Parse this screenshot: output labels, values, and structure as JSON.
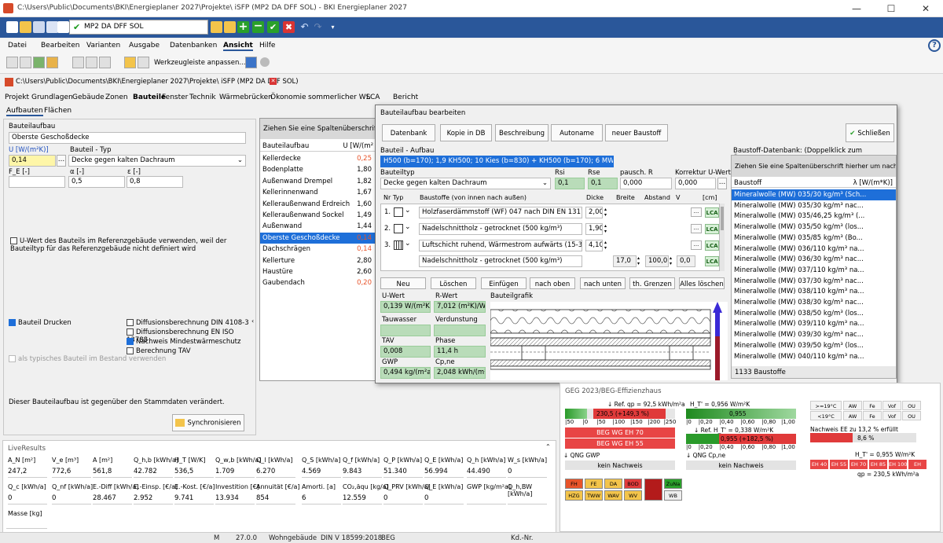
{
  "window": {
    "title": "C:\\Users\\Public\\Documents\\BKI\\Energieplaner 2027\\Projekte\\ iSFP (MP2 DA DFF SOL) - BKI Energieplaner 2027",
    "minimize": "—",
    "maximize": "☐",
    "close": "✕"
  },
  "qat": {
    "combo_value": "MP2 DA DFF SOL"
  },
  "menu": {
    "items": [
      "Datei",
      "Bearbeiten",
      "Varianten",
      "Ausgabe",
      "Datenbanken",
      "Ansicht",
      "Hilfe"
    ],
    "toolbar_customize": "Werkzeugleiste anpassen..."
  },
  "doc": {
    "path": "C:\\Users\\Public\\Documents\\BKI\\Energieplaner 2027\\Projekte\\ iSFP (MP2 DA DFF SOL)"
  },
  "navtabs": [
    "Projekt",
    "Grundlagen",
    "Gebäude",
    "Zonen",
    "Bauteile",
    "Fenster",
    "Technik",
    "Wärmebrücken",
    "Ökonomie",
    "sommerlicher WS",
    "LCA",
    "Bericht"
  ],
  "subtabs": [
    "Aufbauten",
    "Flächen"
  ],
  "left": {
    "bauteilaufbau_label": "Bauteilaufbau",
    "bauteilaufbau_value": "Oberste Geschoßdecke",
    "u_label": "U [W/(m²K)]",
    "u_value": "0,14",
    "typ_label": "Bauteil - Typ",
    "typ_value": "Decke gegen kalten Dachraum",
    "f_label": "F_E [-]",
    "alpha_label": "α [-]",
    "alpha_value": "0,5",
    "eps_label": "ε [-]",
    "eps_value": "0,8",
    "ref_checkbox": "U-Wert des Bauteils im Referenzgebäude verwenden, weil der Bauteiltyp für das Referenzgebäude nicht definiert wird",
    "drucken": "Bauteil Drucken",
    "diff1": "Diffusionsberechnung DIN 4108-3",
    "diff2": "Diffusionsberechnung EN ISO 13788",
    "nachweis": "Nachweis Mindestwärmeschutz",
    "tav": "Berechnung TAV",
    "bestand": "als typisches Bauteil im Bestand verwenden",
    "changed_note": "Dieser Bauteilaufbau ist gegenüber den Stammdaten verändert.",
    "sync_button": "Synchronisieren"
  },
  "grid": {
    "group_hint": "Ziehen Sie eine Spaltenüberschrift hier",
    "col1": "Bauteilaufbau",
    "col2": "U [W/(m²",
    "rows": [
      [
        "Kellerdecke",
        "0,25"
      ],
      [
        "Bodenplatte",
        "1,80"
      ],
      [
        "Außenwand Drempel",
        "1,82"
      ],
      [
        "Kellerinnenwand",
        "1,67"
      ],
      [
        "Kelleraußenwand Erdreich",
        "1,60"
      ],
      [
        "Kelleraußenwand Sockel",
        "1,49"
      ],
      [
        "Außenwand",
        "1,44"
      ],
      [
        "Oberste Geschoßdecke",
        "0,14"
      ],
      [
        "Dachschrägen",
        "0,14"
      ],
      [
        "Kellerture",
        "2,80"
      ],
      [
        "Haustüre",
        "2,60"
      ],
      [
        "Gaubendach",
        "0,20"
      ]
    ]
  },
  "dialog": {
    "title": "Bauteilaufbau bearbeiten",
    "buttons": [
      "Datenbank",
      "Kopie in DB",
      "Beschreibung",
      "Autoname",
      "neuer Baustoff"
    ],
    "close": "Schließen",
    "aufbau_label": "Bauteil - Aufbau",
    "aufbau_value": "H500 (b=170); 1,9 KH500; 10 Kies (b=830) + KH500 (b=170); 6 MW035 (b=830) +",
    "typ_label": "Bauteiltyp",
    "typ_value": "Decke gegen kalten Dachraum",
    "rsi_label": "Rsi",
    "rsi": "0,1",
    "rse_label": "Rse",
    "rse": "0,1",
    "pausch_label": "pausch. R",
    "pausch": "0,000",
    "korr_label": "Korrektur U-Wert",
    "korr": "0,000",
    "table_headers": [
      "Nr Typ",
      "Baustoffe (von innen nach außen)",
      "Dicke",
      "Breite",
      "Abstand",
      "V",
      "[cm]"
    ],
    "layers": [
      {
        "nr": "1.",
        "name": "Holzfaserdämmstoff (WF) 047 nach DIN EN 13171",
        "d": "2,00"
      },
      {
        "nr": "2.",
        "name": "Nadelschnittholz - getrocknet (500 kg/m³)",
        "d": "1,90"
      },
      {
        "nr": "3.",
        "name": "Luftschicht ruhend, Wärmestrom aufwärts (15-300 mm)",
        "d": "4,10"
      }
    ],
    "sub_layer": {
      "name": "Nadelschnittholz - getrocknet (500 kg/m³)",
      "b": "17,0",
      "a": "100,0",
      "v": "0,0"
    },
    "actions": [
      "Neu",
      "Löschen",
      "Einfügen",
      "nach oben",
      "nach unten",
      "th. Grenzen",
      "Alles löschen"
    ],
    "res": {
      "u_label": "U-Wert",
      "u": "0,139 W/(m²K)",
      "r_label": "R-Wert",
      "r": "7,012 (m²K)/W",
      "tw_label": "Tauwasser",
      "ver_label": "Verdunstung",
      "tav_label": "TAV",
      "tav": "0,008",
      "ph_label": "Phase",
      "ph": "11,4 h",
      "gwp_label": "GWP",
      "gwp": "0,494 kg/(m²a)",
      "cp_label": "Cp,ne",
      "cp": "2,048 kWh/(m²a)"
    },
    "grafik_label": "Bauteilgrafik",
    "db_label": "Baustoff-Datenbank: (Doppelklick zum Übernehmen)",
    "db_hint": "Ziehen Sie eine Spaltenüberschrift hierher um nach die",
    "db_col1": "Baustoff",
    "db_col2": "λ [W/(m*K)]",
    "db_rows": [
      "Mineralwolle (MW) 035/30 kg/m³ (Sch...",
      "Mineralwolle (MW) 035/30 kg/m³ nac...",
      "Mineralwolle (MW) 035/46,25 kg/m³ (...",
      "Mineralwolle (MW) 035/50 kg/m³ (los...",
      "Mineralwolle (MW) 035/85 kg/m³ (Bo...",
      "Mineralwolle (MW) 036/110 kg/m³ na...",
      "Mineralwolle (MW) 036/30 kg/m³ nac...",
      "Mineralwolle (MW) 037/110 kg/m³ na...",
      "Mineralwolle (MW) 037/30 kg/m³ nac...",
      "Mineralwolle (MW) 038/110 kg/m³ na...",
      "Mineralwolle (MW) 038/30 kg/m³ nac...",
      "Mineralwolle (MW) 038/50 kg/m³ (los...",
      "Mineralwolle (MW) 039/110 kg/m³ na...",
      "Mineralwolle (MW) 039/30 kg/m³ nac...",
      "Mineralwolle (MW) 039/50 kg/m³ (los...",
      "Mineralwolle (MW) 040/110 kg/m³ na..."
    ],
    "db_count": "1133 Baustoffe"
  },
  "live": {
    "title": "LiveResults",
    "row1_h": [
      "A_N [m²]",
      "V_e [m³]",
      "A [m²]",
      "Q_h,b [kWh/a]",
      "H_T [W/K]",
      "Q_w,b [kWh/a]",
      "Q_l [kWh/a]",
      "Q_S [kWh/a]",
      "Q_f [kWh/a]",
      "Q_P [kWh/a]",
      "Q_E [kWh/a]",
      "Q_h [kWh/a]",
      "W_s [kWh/a]"
    ],
    "row1_v": [
      "247,2",
      "772,6",
      "561,8",
      "42.782",
      "536,5",
      "1.709",
      "6.270",
      "4.569",
      "9.843",
      "51.340",
      "56.994",
      "44.490",
      "0"
    ],
    "row2_h": [
      "Q_c [kWh/a]",
      "Q_nf [kWh/a]",
      "E.-Diff [kWh/a]",
      "E.-Einsp. [€/a]",
      "E.-Kost. [€/a]",
      "Investition [€]",
      "Annuität [€/a]",
      "Amorti. [a]",
      "CO₂,äqu [kg/a]",
      "Q_PRV [kWh/a]",
      "Q_E [kWh/a]",
      "GWP [kg/m²a]",
      "Q_h,BW [kWh/a]"
    ],
    "row2_v": [
      "0",
      "0",
      "28.467",
      "2.952",
      "9.741",
      "13.934",
      "854",
      "6",
      "12.559",
      "0",
      "0",
      "",
      ""
    ],
    "masse_label": "Masse [kg]"
  },
  "geg": {
    "title": "GEG 2023/BEG-Effizienzhaus",
    "ref_qp": "Ref. qp = 92,5 kWh/m²a",
    "bar1": "230,5 (+149,3 %)",
    "ticks1": [
      "|50",
      "|0",
      "|50",
      "|100",
      "|150",
      "|200",
      "|250"
    ],
    "beg1": "BEG WG EH 70",
    "beg2": "BEG WG EH 55",
    "ht_label": "H_T' = 0,956 W/m²K",
    "bar2": "0,955",
    "ticks2": [
      "|0",
      "|0,20",
      "|0,40",
      "|0,60",
      "|0,80",
      "|1,00"
    ],
    "ref_ht": "Ref. H_T' = 0,338 W/m²K",
    "bar3": "0,955 (+182,5 %)",
    "qng_gwp": "QNG GWP",
    "qng_cp": "QNG Cp,ne",
    "kein": "kein Nachweis",
    "small_tags": [
      "FH",
      "FE",
      "DA",
      "BOD",
      "ZuNa",
      "HZG",
      "TWW",
      "WAV",
      "WV",
      "WB"
    ],
    "tbl_rows": [
      [
        ">=19°C",
        "AW",
        "Fe",
        "Vof",
        "OU"
      ],
      [
        "<19°C",
        "AW",
        "Fe",
        "Vof",
        "OU"
      ]
    ],
    "ee": "Nachweis EE zu 13,2 % erfüllt",
    "ee_val": "8,6 %",
    "ht2": "H_T' = 0,955 W/m²K",
    "eh": [
      "EH 40",
      "EH 55",
      "EH 70",
      "EH 85",
      "EH 100",
      "EH"
    ],
    "qp": "qp = 230,5 kWh/m²a"
  },
  "status": {
    "items": [
      "M",
      "27.0.0",
      "Wohngebäude",
      "DIN V 18599:2018",
      "BEG",
      "Kd.-Nr."
    ]
  },
  "colors": {
    "accent": "#2a579a",
    "selection": "#1e6fd9",
    "red": "#e03a3a",
    "green": "#2aa02a"
  }
}
